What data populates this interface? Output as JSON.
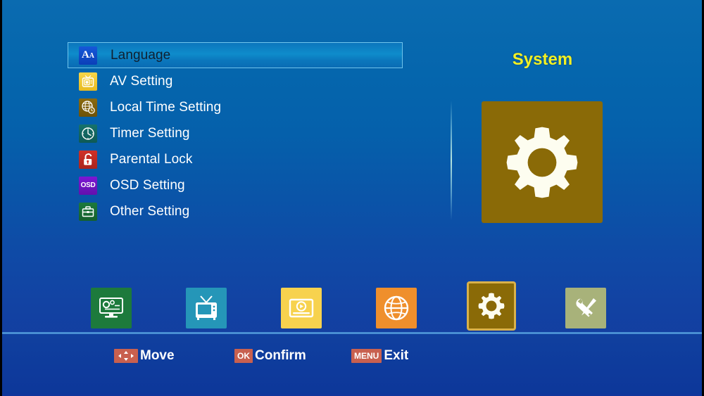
{
  "screen": {
    "background_top": "#0a6bb0",
    "background_bottom": "#10359b"
  },
  "menu": {
    "selected_index": 0,
    "items": [
      {
        "label": "Language",
        "icon": "language-icon",
        "icon_color": "#1658d8"
      },
      {
        "label": "AV Setting",
        "icon": "tv-camera-icon",
        "icon_color": "#f7d649"
      },
      {
        "label": "Local Time Setting",
        "icon": "globe-clock-icon",
        "icon_color": "#8a6a10"
      },
      {
        "label": "Timer Setting",
        "icon": "clock-icon",
        "icon_color": "#17726b"
      },
      {
        "label": "Parental Lock",
        "icon": "lock-open-icon",
        "icon_color": "#cf3028"
      },
      {
        "label": "OSD Setting",
        "icon": "osd-icon",
        "icon_color": "#7d17d4"
      },
      {
        "label": "Other Setting",
        "icon": "briefcase-icon",
        "icon_color": "#1d7a3c"
      }
    ]
  },
  "panel": {
    "title": "System",
    "title_color": "#f2f024",
    "preview_icon": "gear-icon",
    "preview_color": "#8a6a07"
  },
  "icon_bar": {
    "selected_index": 4,
    "items": [
      {
        "name": "installation",
        "icon": "monitor-gears-icon",
        "color": "#1d7a3c"
      },
      {
        "name": "channel",
        "icon": "tv-icon",
        "color": "#2596b8"
      },
      {
        "name": "media",
        "icon": "video-play-icon",
        "color": "#f7d24e"
      },
      {
        "name": "network",
        "icon": "globe-icon",
        "color": "#ef8f2c"
      },
      {
        "name": "system",
        "icon": "gear-icon",
        "color": "#8a6a07"
      },
      {
        "name": "tools",
        "icon": "tools-icon",
        "color": "#a8b27a"
      }
    ],
    "selected_border_color": "#d9b14a"
  },
  "footer": {
    "badge_color": "#c8604f",
    "hints": [
      {
        "key": "arrows",
        "key_label": "",
        "action": "Move"
      },
      {
        "key": "ok",
        "key_label": "OK",
        "action": "Confirm"
      },
      {
        "key": "menu",
        "key_label": "MENU",
        "action": "Exit"
      }
    ]
  }
}
